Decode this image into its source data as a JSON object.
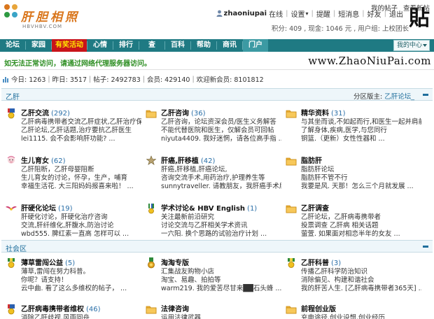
{
  "header": {
    "logo_title": "肝胆相照",
    "logo_sub": "HBVHBV.COM",
    "user": {
      "name": "zhaoniupai",
      "status": "在线",
      "links": [
        "设置",
        "提醒",
        "短消息",
        "好友",
        "退出"
      ],
      "settings_arrow": "▾"
    },
    "stats": "积分: 409 , 现金: 1046 元 , 用户组: 上校团长",
    "signature_glyph": "貼"
  },
  "nav": {
    "items": [
      "论坛",
      "家园",
      "有奖活动",
      "心情",
      "排行",
      "查",
      "百科",
      "帮助",
      "商讯",
      "门户"
    ],
    "my_center": "我的中心"
  },
  "notice": {
    "text": "如无法正常访问，请通过网络代理服务器访问。",
    "watermark": "www.ZhaoNiuPai.com"
  },
  "strip": {
    "today": "今日: 1263",
    "yesterday": "昨日: 3517",
    "posts": "帖子: 2492783",
    "members": "会员: 429140",
    "welcome": "欢迎新会员: 8101812",
    "my_posts": "我的帖子",
    "new_posts": "查看新帖"
  },
  "sections": [
    {
      "title": "乙肝",
      "moderator_label": "分区版主: ",
      "moderator": "乙肝论坛_",
      "forums": [
        {
          "icon": "sun-badge-icon",
          "name": "乙肝交流",
          "count": "(292)",
          "l1": "乙肝病毒携带者交流乙肝症状,乙肝治疗保健",
          "l2": "乙肝论坛,乙肝话题,治疗要抗乙肝医生",
          "l3": "lei1115. 会不会影响肝功能?  ..."
        },
        {
          "icon": "folder-icon",
          "name": "乙肝咨询",
          "count": "(36)",
          "l1": "乙肝咨询，论坛资深会员/医生义务解答",
          "l2": "不能代替医院和医生，仅解会员可回帖",
          "l3": "niyuta4409. 我好迷惘，请各位高手指  ..."
        },
        {
          "icon": "folder-icon",
          "name": "精华资料",
          "count": "(31)",
          "l1": "与其坐而谈,不如起而行,和医生一起并肩前进",
          "l2": "了解身体,疾病,医学,与您同行",
          "l3": "铜篮.（更新）女性性器和  ..."
        },
        {
          "icon": "baby-icon",
          "name": "生儿育女",
          "count": "(62)",
          "l1": "乙肝阻断，乙肝母婴阻断",
          "l2": "生儿育女的讨论，怀孕，生产，哺育",
          "l3": "幸福生活花. 大三阳妈妈报喜来啦！  ..."
        },
        {
          "icon": "medal-icon",
          "name": "肝癌,肝移植",
          "count": "(42)",
          "l1": "肝癌,肝移植,肝癌论坛,",
          "l2": "咨询交流手术,用药治疗,护理养生等",
          "l3": "sunnytraveller. 请教朋友，我肝癌手术后  ..."
        },
        {
          "icon": "folder-icon",
          "name": "脂肪肝",
          "count": "",
          "l1": "脂肪肝论坛",
          "l2": "脂肪肝不管不行",
          "l3": "我要是风. 天那！怎么三个月就发展  ..."
        },
        {
          "icon": "wings-icon",
          "name": "肝硬化论坛",
          "count": "(19)",
          "l1": "肝硬化讨论，肝硬化治疗咨询",
          "l2": "交流,肝纤维化,肝腹水,防治讨论",
          "l3": "wbd555. 脾红素一直高 怎样可以  ..."
        },
        {
          "icon": "stripe-badge-icon",
          "name": "学术讨论& HBV English",
          "count": "(1)",
          "l1": "关注最新前沿研究",
          "l2": "讨论交流与乙肝相关学术资讯",
          "l3": "一六阳. 换个思路的试验治疗计划  ..."
        },
        {
          "icon": "folder-icon",
          "name": "乙肝调查",
          "count": "",
          "l1": "乙肝论坛，乙肝病毒携带者",
          "l2": "投票调查 乙肝病 相关话题",
          "l3": "萤萱. 如果面对相恋半年的女友  ..."
        }
      ]
    },
    {
      "title": "社会区",
      "moderator_label": "",
      "moderator": "",
      "forums": [
        {
          "icon": "green-medal-icon",
          "name": "薄草雷闯公益",
          "count": "(5)",
          "l1": "薄草,雷闯在努力科普。",
          "l2": "你呢？请支持！",
          "l3": "云中曲. 看了这么多维权的帖子，  ..."
        },
        {
          "icon": "gold-medal-icon",
          "name": "淘淘专版",
          "count": "",
          "l1": "汇集战友购物小店",
          "l2": "淘宝、易趣、拍拍等",
          "l3": "warm219. 我的爱苦尽甘来██石头蜂  ..."
        },
        {
          "icon": "green-medal-icon",
          "name": "乙肝科普",
          "count": "(3)",
          "l1": "传播乙肝科学防治知识",
          "l2": "消除偏见、构建和谐社会",
          "l3": "我的肝苦人生. [乙肝病毒携带者365天]  ..."
        },
        {
          "icon": "sun-badge-icon",
          "name": "乙肝病毒携带者维权",
          "count": "(46)",
          "l1": "消除乙肝歧视,风雨同舟",
          "l2": "",
          "l3": ""
        },
        {
          "icon": "folder-icon",
          "name": "法律咨询",
          "count": "",
          "l1": "运用法律武器",
          "l2": "",
          "l3": ""
        },
        {
          "icon": "folder-icon",
          "name": "前程创业版",
          "count": "",
          "l1": "充电途径,创业设想,创业经历",
          "l2": "",
          "l3": ""
        }
      ]
    }
  ],
  "colors": {
    "nav_bg": "#1f7a83",
    "nav_hot": "#c8141a",
    "notice_green": "#2f8f24",
    "section_blue": "#1f6e9c"
  }
}
